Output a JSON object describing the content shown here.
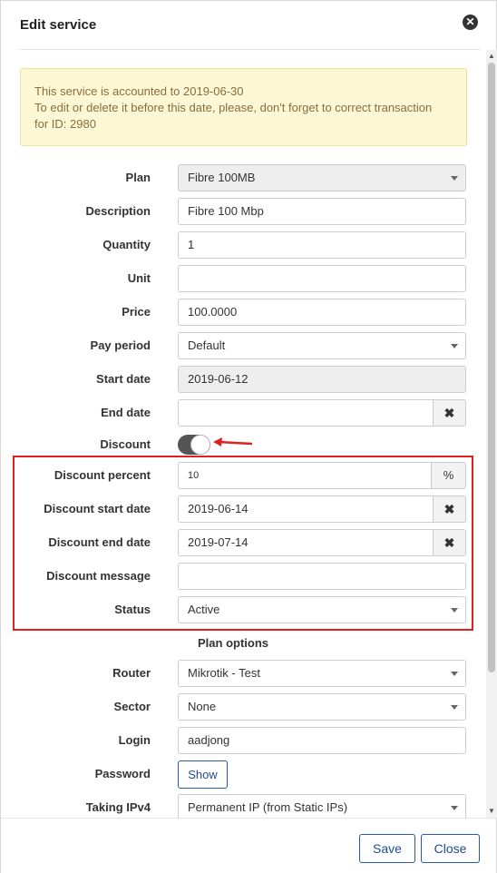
{
  "modal": {
    "title": "Edit service",
    "close_icon": "close-circle-icon"
  },
  "alert": {
    "line1": "This service is accounted to 2019-06-30",
    "line2": "To edit or delete it before this date, please, don't forget to correct transaction",
    "line3": "for ID: 2980"
  },
  "form": {
    "plan": {
      "label": "Plan",
      "value": "Fibre 100MB"
    },
    "description": {
      "label": "Description",
      "value": "Fibre 100 Mbp"
    },
    "quantity": {
      "label": "Quantity",
      "value": "1"
    },
    "unit": {
      "label": "Unit",
      "value": ""
    },
    "price": {
      "label": "Price",
      "value": "100.0000"
    },
    "pay_period": {
      "label": "Pay period",
      "value": "Default"
    },
    "start_date": {
      "label": "Start date",
      "value": "2019-06-12"
    },
    "end_date": {
      "label": "End date",
      "value": "",
      "clear_icon": "✖"
    },
    "discount": {
      "label": "Discount",
      "enabled": true
    },
    "discount_percent": {
      "label": "Discount percent",
      "value": "10",
      "suffix": "%"
    },
    "discount_start_date": {
      "label": "Discount start date",
      "value": "2019-06-14",
      "clear_icon": "✖"
    },
    "discount_end_date": {
      "label": "Discount end date",
      "value": "2019-07-14",
      "clear_icon": "✖"
    },
    "discount_message": {
      "label": "Discount message",
      "value": ""
    },
    "status": {
      "label": "Status",
      "value": "Active"
    }
  },
  "plan_options": {
    "title": "Plan options",
    "router": {
      "label": "Router",
      "value": "Mikrotik - Test"
    },
    "sector": {
      "label": "Sector",
      "value": "None"
    },
    "login": {
      "label": "Login",
      "value": "aadjong"
    },
    "password": {
      "label": "Password",
      "button": "Show"
    },
    "taking_ipv4": {
      "label": "Taking IPv4",
      "value": "Permanent IP (from Static IPs)"
    }
  },
  "footer": {
    "save_label": "Save",
    "close_label": "Close"
  },
  "colors": {
    "highlight_border": "#e02020",
    "alert_bg": "#fcf8d6",
    "alert_text": "#8a6d3b",
    "button_blue": "#1f4c8f"
  }
}
